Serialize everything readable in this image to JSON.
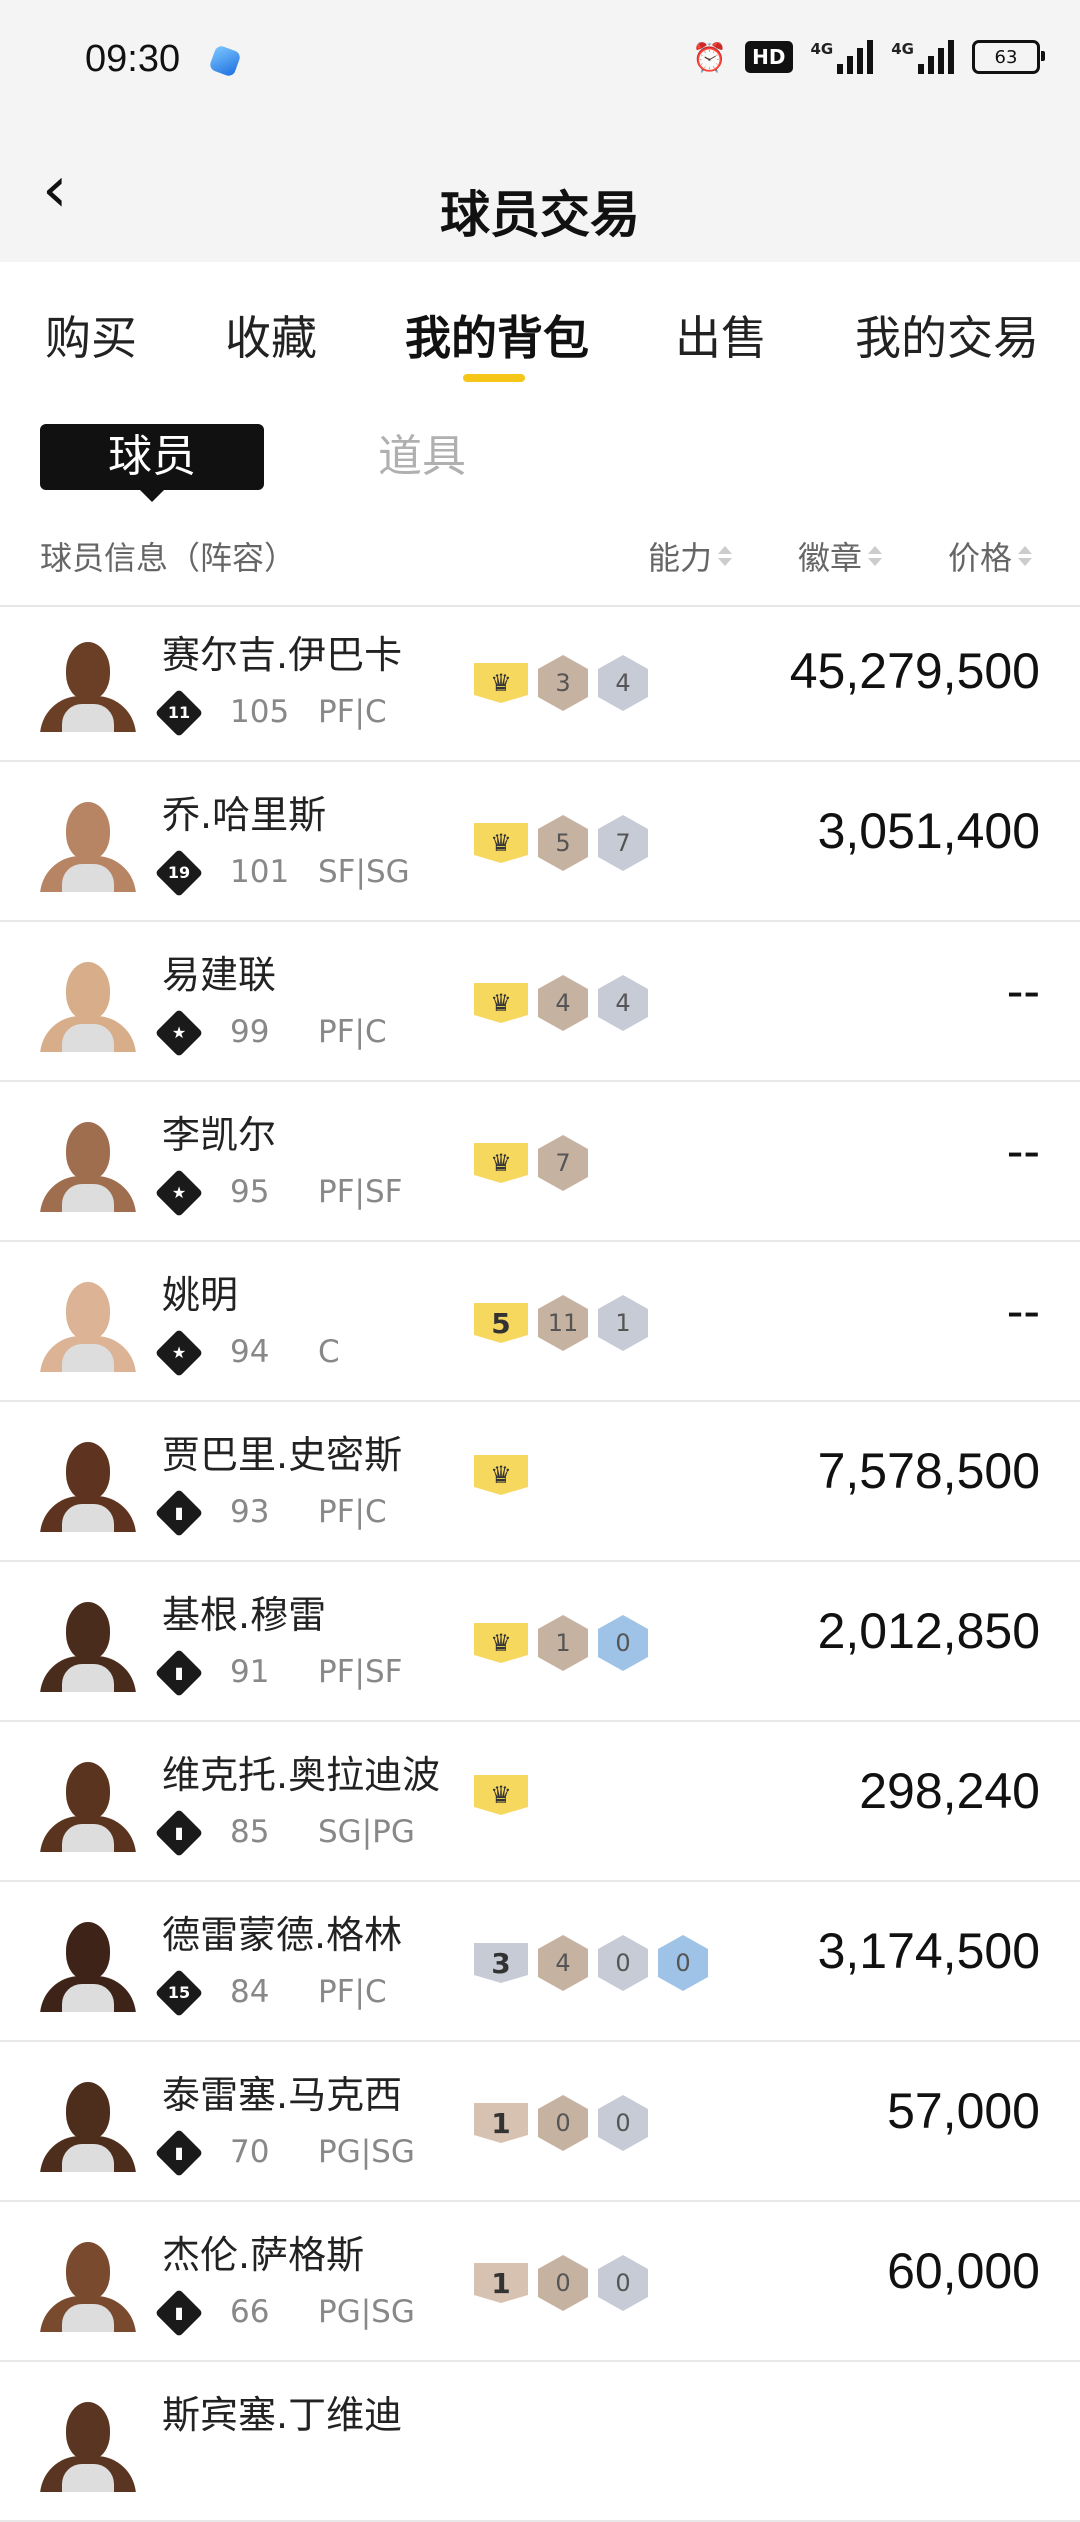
{
  "status_bar": {
    "time": "09:30",
    "battery": "63",
    "network": "4G"
  },
  "header": {
    "title": "球员交易",
    "back_icon": "chevron-left-icon"
  },
  "tabs": [
    {
      "label": "购买"
    },
    {
      "label": "收藏"
    },
    {
      "label": "我的背包",
      "active": true
    },
    {
      "label": "出售"
    },
    {
      "label": "我的交易"
    }
  ],
  "subtabs": {
    "active": "球员",
    "inactive": "道具"
  },
  "columns": {
    "info": "球员信息（阵容）",
    "ability": "能力",
    "badges": "徽章",
    "price": "价格"
  },
  "colors": {
    "accent": "#f5c518",
    "crown": "#f7d85e",
    "bronze": "#c6b2a1",
    "silver": "#c7cbd6",
    "blue": "#9fc3e6"
  },
  "players": [
    {
      "name": "赛尔吉.伊巴卡",
      "badge": "11",
      "rating": "105",
      "pos": "PF|C",
      "crown": "",
      "b": [
        "3",
        "4"
      ],
      "bt": [
        "bronze",
        "silver"
      ],
      "price": "45,279,500",
      "skin": "#6b3f26"
    },
    {
      "name": "乔.哈里斯",
      "badge": "19",
      "rating": "101",
      "pos": "SF|SG",
      "crown": "",
      "b": [
        "5",
        "7"
      ],
      "bt": [
        "bronze",
        "silver"
      ],
      "price": "3,051,400",
      "skin": "#b78464"
    },
    {
      "name": "易建联",
      "badge": "★",
      "rating": "99",
      "pos": "PF|C",
      "crown": "",
      "b": [
        "4",
        "4"
      ],
      "bt": [
        "bronze",
        "silver"
      ],
      "price": "--",
      "skin": "#d8ad89"
    },
    {
      "name": "李凯尔",
      "badge": "★",
      "rating": "95",
      "pos": "PF|SF",
      "crown": "",
      "b": [
        "7"
      ],
      "bt": [
        "bronze"
      ],
      "price": "--",
      "skin": "#9e6e4e"
    },
    {
      "name": "姚明",
      "badge": "★",
      "rating": "94",
      "pos": "C",
      "crown": "5",
      "b": [
        "11",
        "1"
      ],
      "bt": [
        "bronze",
        "silver"
      ],
      "price": "--",
      "skin": "#dcb394"
    },
    {
      "name": "贾巴里.史密斯",
      "badge": "▮",
      "rating": "93",
      "pos": "PF|C",
      "crown": "",
      "b": [],
      "bt": [],
      "price": "7,578,500",
      "skin": "#5e3420"
    },
    {
      "name": "基根.穆雷",
      "badge": "▮",
      "rating": "91",
      "pos": "PF|SF",
      "crown": "",
      "b": [
        "1",
        "0"
      ],
      "bt": [
        "bronze",
        "blue"
      ],
      "price": "2,012,850",
      "skin": "#4a2c1c"
    },
    {
      "name": "维克托.奥拉迪波",
      "badge": "▮",
      "rating": "85",
      "pos": "SG|PG",
      "crown": "",
      "b": [],
      "bt": [],
      "price": "298,240",
      "skin": "#5b341f"
    },
    {
      "name": "德雷蒙德.格林",
      "badge": "15",
      "rating": "84",
      "pos": "PF|C",
      "crown": "3",
      "b": [
        "4",
        "0",
        "0"
      ],
      "bt": [
        "bronze",
        "silver",
        "blue"
      ],
      "price": "3,174,500",
      "skin": "#3e2418"
    },
    {
      "name": "泰雷塞.马克西",
      "badge": "▮",
      "rating": "70",
      "pos": "PG|SG",
      "crown": "1",
      "b": [
        "0",
        "0"
      ],
      "bt": [
        "bronze",
        "silver"
      ],
      "price": "57,000",
      "skin": "#4d2d1c"
    },
    {
      "name": "杰伦.萨格斯",
      "badge": "▮",
      "rating": "66",
      "pos": "PG|SG",
      "crown": "1",
      "b": [
        "0",
        "0"
      ],
      "bt": [
        "bronze",
        "silver"
      ],
      "price": "60,000",
      "skin": "#7a4a2e"
    },
    {
      "name": "斯宾塞.丁维迪",
      "badge": "▮",
      "rating": "",
      "pos": "",
      "crown": "",
      "b": [],
      "bt": [],
      "price": "",
      "skin": "#5a3521"
    }
  ]
}
